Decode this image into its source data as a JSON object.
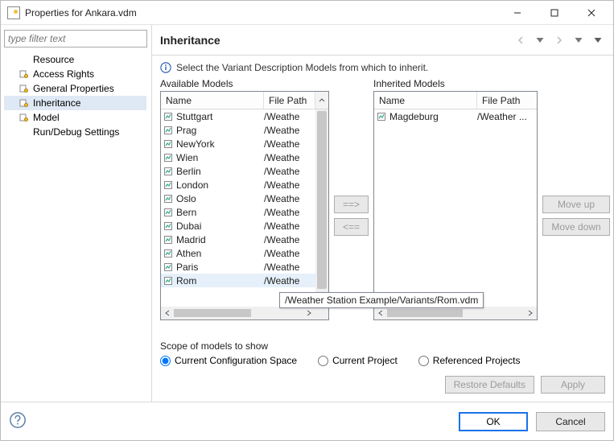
{
  "window": {
    "title": "Properties for Ankara.vdm"
  },
  "sidebar": {
    "filter_placeholder": "type filter text",
    "items": [
      {
        "label": "Resource",
        "icon": null
      },
      {
        "label": "Access Rights",
        "icon": "config"
      },
      {
        "label": "General Properties",
        "icon": "config"
      },
      {
        "label": "Inheritance",
        "icon": "config",
        "selected": true
      },
      {
        "label": "Model",
        "icon": "config"
      },
      {
        "label": "Run/Debug Settings",
        "icon": null
      }
    ]
  },
  "header": {
    "title": "Inheritance"
  },
  "info_text": "Select the Variant Description Models from which to inherit.",
  "available": {
    "title": "Available Models",
    "columns": {
      "name": "Name",
      "path": "File Path"
    },
    "rows": [
      {
        "name": "Stuttgart",
        "path": "/Weathe"
      },
      {
        "name": "Prag",
        "path": "/Weathe"
      },
      {
        "name": "NewYork",
        "path": "/Weathe"
      },
      {
        "name": "Wien",
        "path": "/Weathe"
      },
      {
        "name": "Berlin",
        "path": "/Weathe"
      },
      {
        "name": "London",
        "path": "/Weathe"
      },
      {
        "name": "Oslo",
        "path": "/Weathe"
      },
      {
        "name": "Bern",
        "path": "/Weathe"
      },
      {
        "name": "Dubai",
        "path": "/Weathe"
      },
      {
        "name": "Madrid",
        "path": "/Weathe"
      },
      {
        "name": "Athen",
        "path": "/Weathe"
      },
      {
        "name": "Paris",
        "path": "/Weathe"
      },
      {
        "name": "Rom",
        "path": "/Weathe",
        "selected": true
      }
    ]
  },
  "inherited": {
    "title": "Inherited Models",
    "columns": {
      "name": "Name",
      "path": "File Path"
    },
    "rows": [
      {
        "name": "Magdeburg",
        "path": "/Weather ..."
      }
    ]
  },
  "tooltip": "/Weather Station Example/Variants/Rom.vdm",
  "buttons": {
    "add": "==>",
    "remove": "<==",
    "move_up": "Move up",
    "move_down": "Move down",
    "restore": "Restore Defaults",
    "apply": "Apply",
    "ok": "OK",
    "cancel": "Cancel"
  },
  "scope": {
    "title": "Scope of models to show",
    "options": [
      {
        "label": "Current Configuration Space",
        "checked": true
      },
      {
        "label": "Current Project",
        "checked": false
      },
      {
        "label": "Referenced Projects",
        "checked": false
      }
    ]
  }
}
